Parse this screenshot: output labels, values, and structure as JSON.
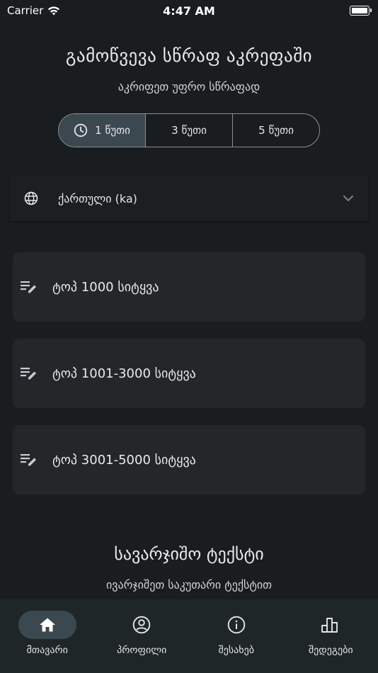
{
  "status_bar": {
    "carrier": "Carrier",
    "time": "4:47 AM"
  },
  "header": {
    "title": "გამოწვევა სწრაფ აკრეფაში",
    "subtitle": "აკრიფეთ უფრო სწრაფად"
  },
  "duration_options": [
    {
      "label": "1 წუთი",
      "selected": true
    },
    {
      "label": "3 წუთი",
      "selected": false
    },
    {
      "label": "5 წუთი",
      "selected": false
    }
  ],
  "language": {
    "selected": "ქართული (ka)"
  },
  "word_sets": [
    {
      "label": "ტოპ 1000 სიტყვა"
    },
    {
      "label": "ტოპ 1001-3000 სიტყვა"
    },
    {
      "label": "ტოპ 3001-5000 სიტყვა"
    }
  ],
  "custom_text": {
    "title": "სავარჯიშო ტექსტი",
    "subtitle": "ივარჯიშეთ საკუთარი ტექსტით"
  },
  "tabs": [
    {
      "label": "მთავარი",
      "icon": "home-icon",
      "active": true
    },
    {
      "label": "პროფილი",
      "icon": "profile-icon",
      "active": false
    },
    {
      "label": "შესახებ",
      "icon": "info-icon",
      "active": false
    },
    {
      "label": "შედეგები",
      "icon": "leaderboard-icon",
      "active": false
    }
  ],
  "colors": {
    "background": "#1a1d1f",
    "card": "#23272a",
    "active": "#3c484f",
    "tabbar": "#1f2628"
  }
}
